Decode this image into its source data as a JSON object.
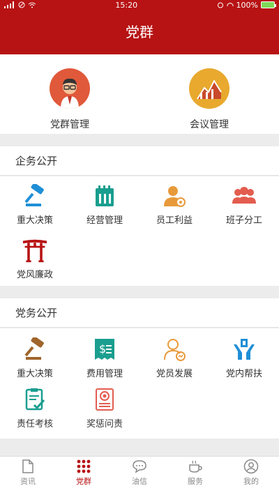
{
  "status": {
    "time": "15:20",
    "battery": "100%"
  },
  "header": {
    "title": "党群"
  },
  "top_cards": [
    {
      "label": "党群管理",
      "icon": "person-icon"
    },
    {
      "label": "会议管理",
      "icon": "chart-icon"
    }
  ],
  "enterprise": {
    "title": "企务公开",
    "items": [
      {
        "label": "重大决策"
      },
      {
        "label": "经营管理"
      },
      {
        "label": "员工利益"
      },
      {
        "label": "班子分工"
      },
      {
        "label": "党风廉政"
      }
    ]
  },
  "party": {
    "title": "党务公开",
    "items": [
      {
        "label": "重大决策"
      },
      {
        "label": "费用管理"
      },
      {
        "label": "党员发展"
      },
      {
        "label": "党内帮扶"
      },
      {
        "label": "责任考核"
      },
      {
        "label": "奖惩问责"
      }
    ]
  },
  "tabs": [
    {
      "label": "资讯"
    },
    {
      "label": "党群"
    },
    {
      "label": "油信"
    },
    {
      "label": "服务"
    },
    {
      "label": "我的"
    }
  ],
  "colors": {
    "brand": "#b71314",
    "accent_teal": "#1a9e8f",
    "accent_orange": "#e89a3a",
    "accent_blue": "#1f8fd6"
  }
}
